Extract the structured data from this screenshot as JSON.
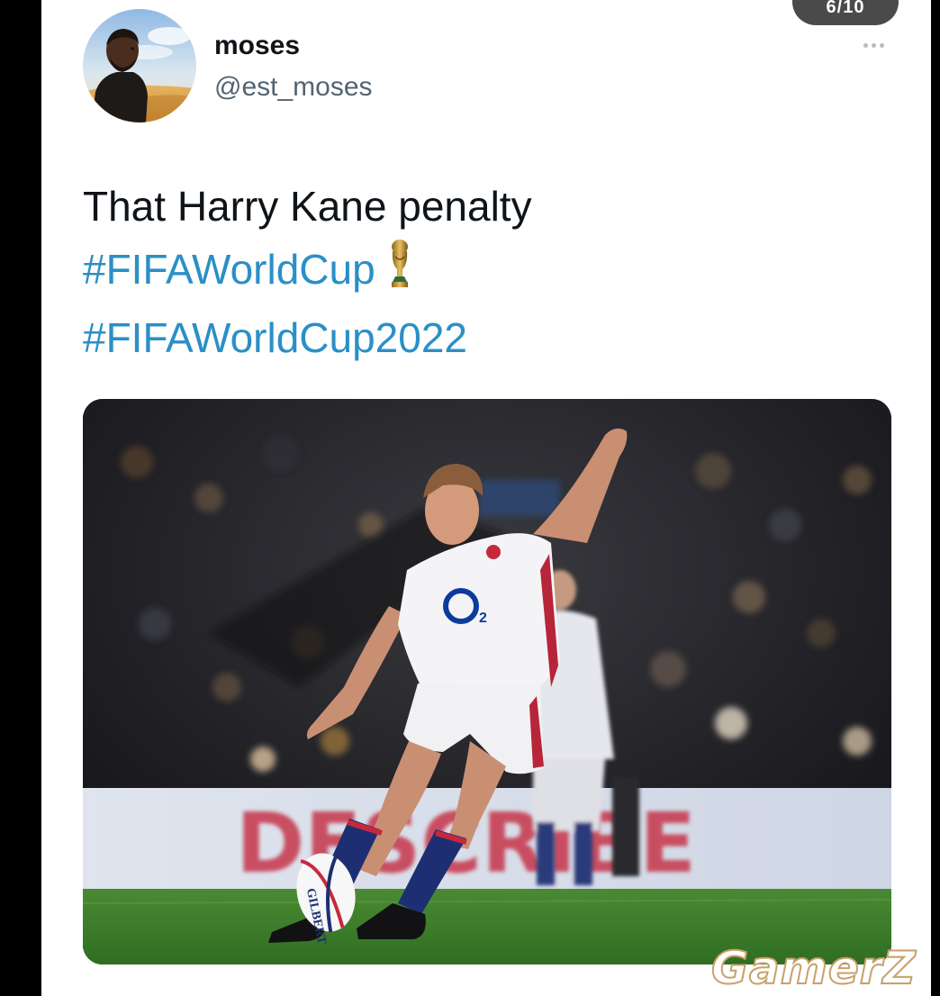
{
  "pager": {
    "counter": "6/10"
  },
  "tweet": {
    "display_name": "moses",
    "handle": "@est_moses",
    "text_line": "That Harry Kane penalty",
    "hashtags": [
      "#FIFAWorldCup",
      "#FIFAWorldCup2022"
    ],
    "trophy_icon": "trophy-icon",
    "more_icon": "more-horizontal-icon"
  },
  "media": {
    "jersey_sponsor": "O2",
    "ball_brand": "GILBERT",
    "board_text": "DESCRIBE"
  },
  "watermark": {
    "text": "GamerZ"
  },
  "colors": {
    "hashtag": "#2b8fc6",
    "text": "#0f1419",
    "secondary": "#536471"
  }
}
